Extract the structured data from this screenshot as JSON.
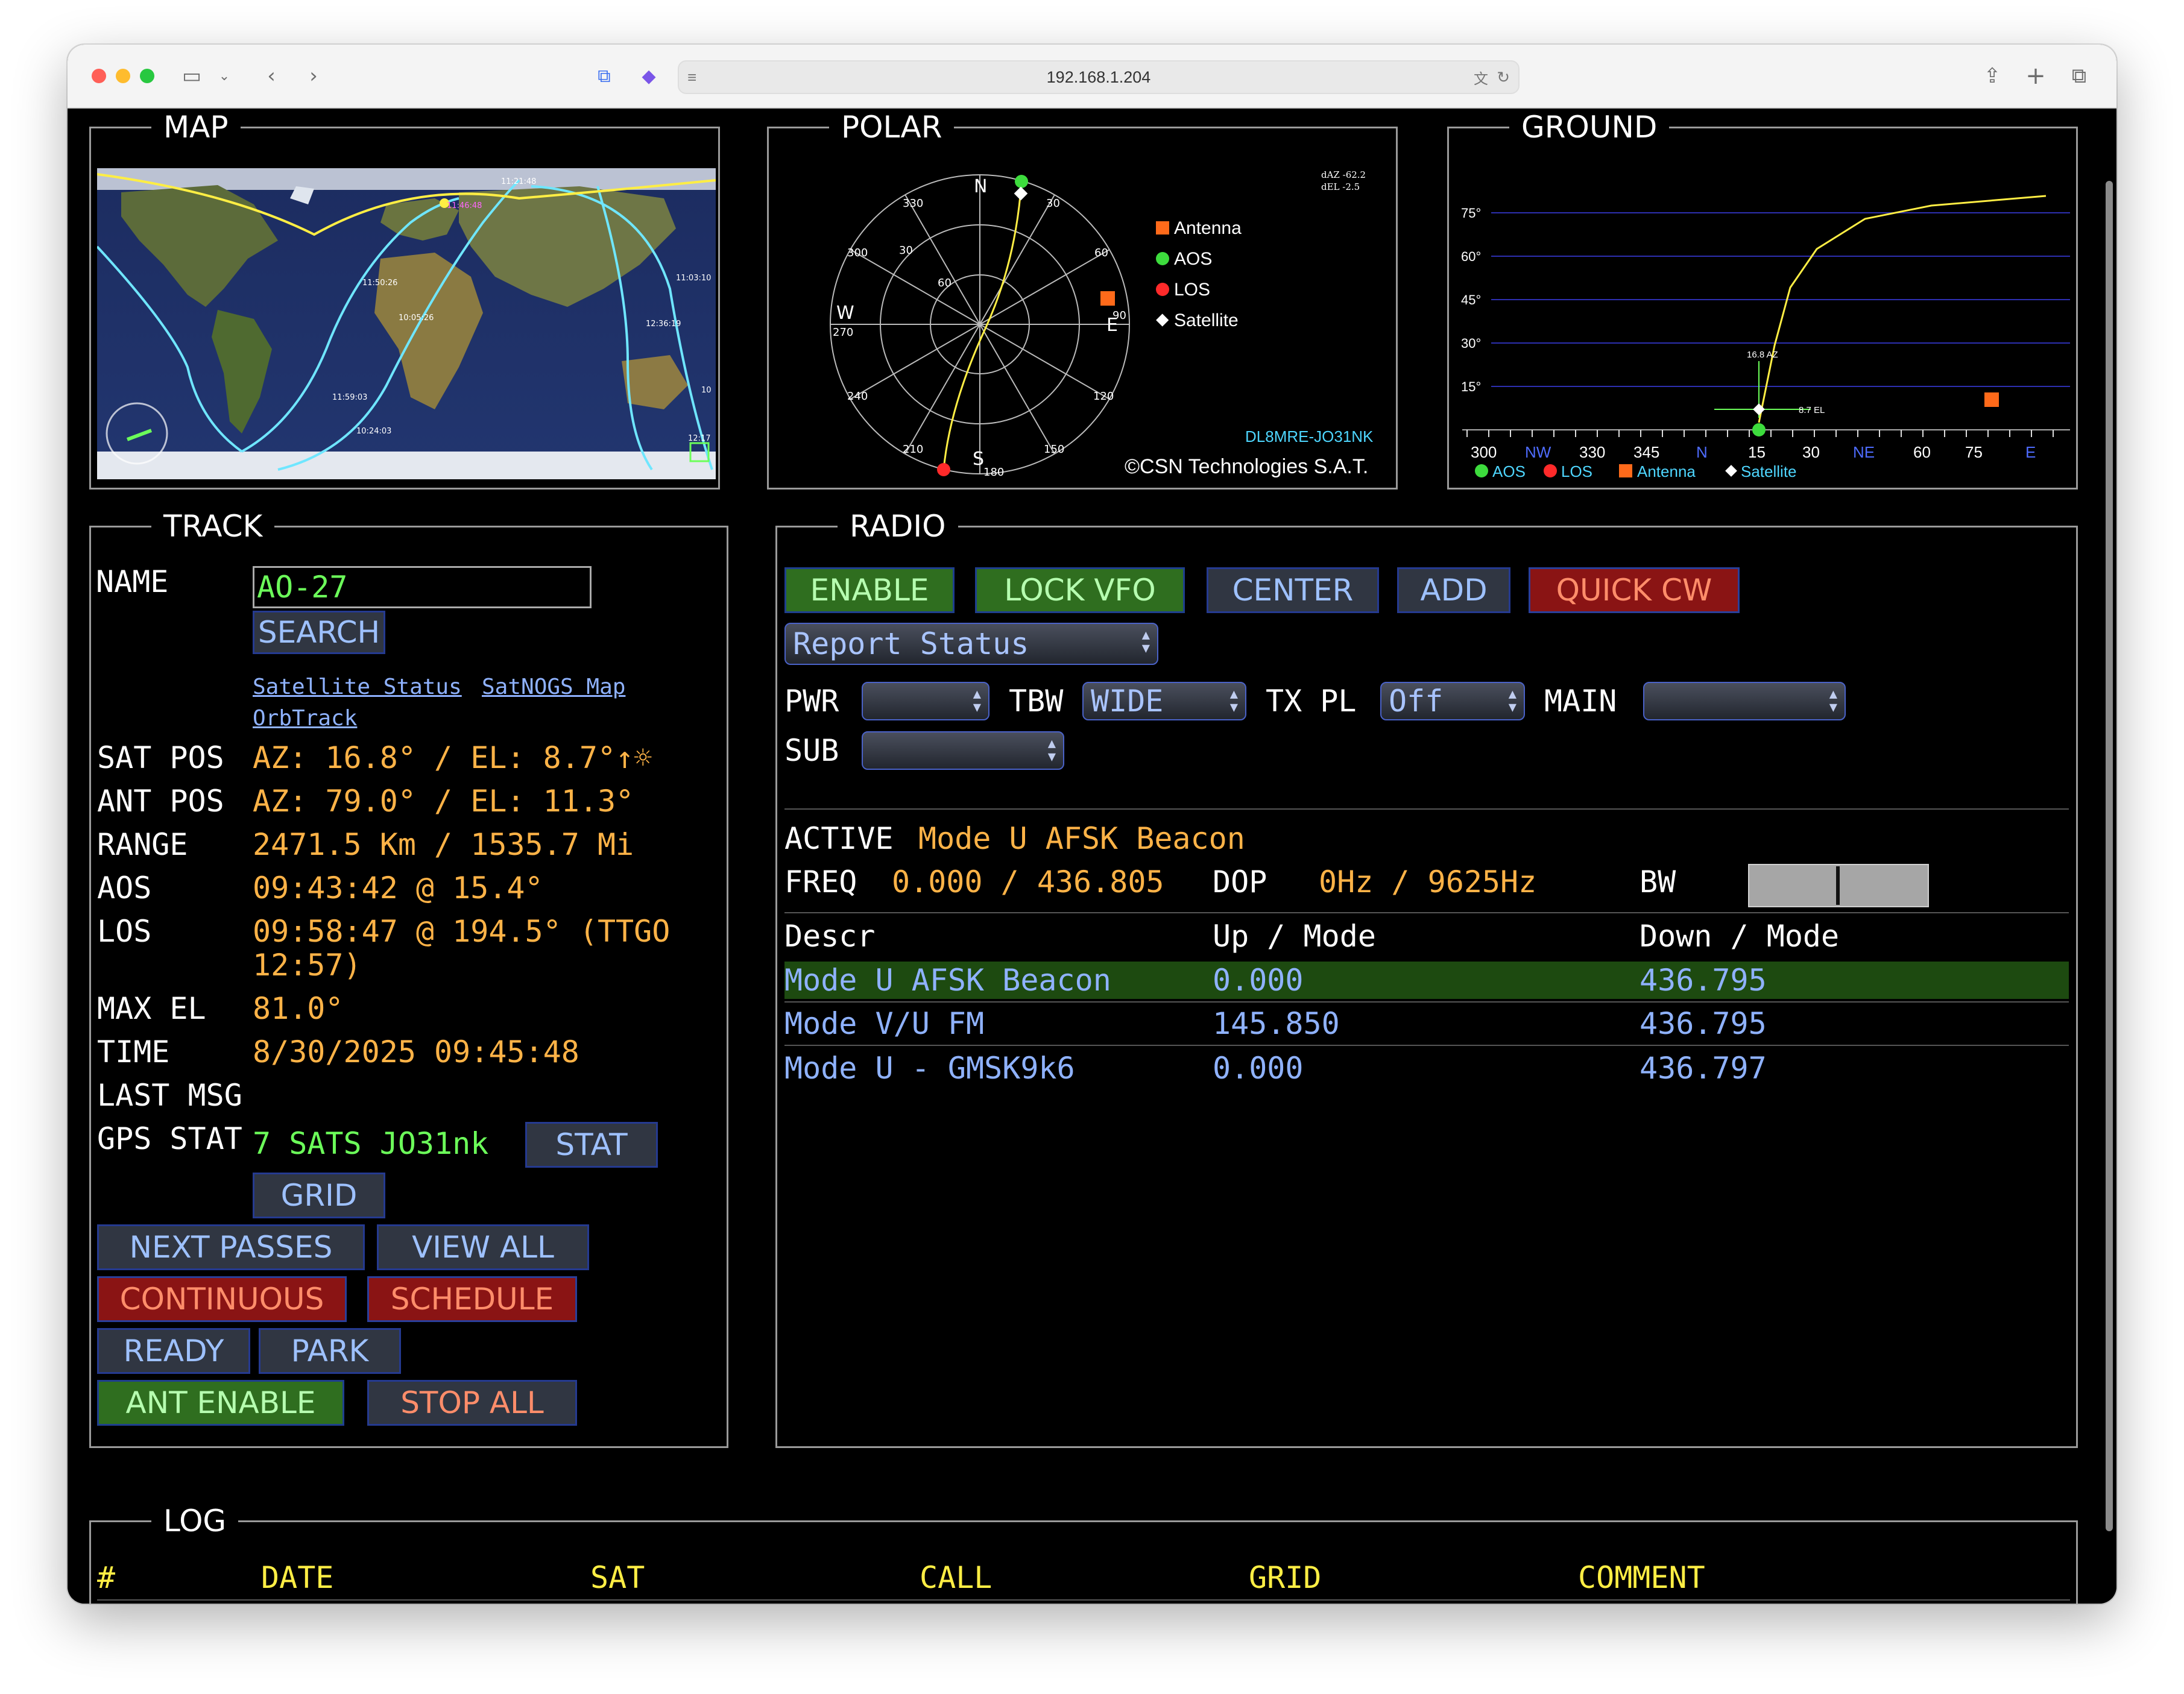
{
  "browser": {
    "url": "192.168.1.204"
  },
  "map": {
    "title": "MAP",
    "times": [
      "11:21:48",
      "11:46:48",
      "11:50:26",
      "11:03:10",
      "10:05:26",
      "12:36:19",
      "11:59:03",
      "10",
      "10:24:03",
      "12:17"
    ]
  },
  "polar": {
    "title": "POLAR",
    "daz": "dAZ -62.2",
    "del": "dEL -2.5",
    "legend": [
      "Antenna",
      "AOS",
      "LOS",
      "Satellite"
    ],
    "directions": [
      "N",
      "E",
      "S",
      "W"
    ],
    "degrees": [
      "330",
      "30",
      "300",
      "60",
      "270",
      "90",
      "240",
      "120",
      "210",
      "150",
      "180"
    ],
    "rings": [
      "30",
      "60"
    ],
    "callsign": "DL8MRE-JO31NK",
    "copyright": "©CSN Technologies S.A.T.",
    "colors": {
      "antenna": "#ff6a1a",
      "aos": "#3ddc3d",
      "los": "#ff2a2a",
      "track": "#ffee44"
    }
  },
  "ground": {
    "title": "GROUND",
    "y_ticks": [
      "75°",
      "60°",
      "45°",
      "30°",
      "15°"
    ],
    "x_ticks": [
      "300",
      "NW",
      "330",
      "345",
      "N",
      "15",
      "30",
      "NE",
      "60",
      "75",
      "E"
    ],
    "az_label": "16.8 AZ",
    "el_label": "8.7 EL",
    "legend": [
      "AOS",
      "LOS",
      "Antenna",
      "Satellite"
    ]
  },
  "track": {
    "title": "TRACK",
    "name_label": "NAME",
    "name_value": "AO-27",
    "search": "SEARCH",
    "links": [
      "Satellite Status",
      "SatNOGS Map",
      "OrbTrack"
    ],
    "rows": [
      {
        "label": "SAT POS",
        "value": "AZ: 16.8° / EL: 8.7°↑☼"
      },
      {
        "label": "ANT POS",
        "value": "AZ: 79.0° / EL: 11.3°"
      },
      {
        "label": "RANGE",
        "value": "2471.5 Km / 1535.7 Mi"
      },
      {
        "label": "AOS",
        "value": "09:43:42 @ 15.4°"
      },
      {
        "label": "LOS",
        "value": "09:58:47 @ 194.5° (TTGO"
      },
      {
        "label": "",
        "value": "12:57)"
      },
      {
        "label": "MAX EL",
        "value": "81.0°"
      },
      {
        "label": "TIME",
        "value": "8/30/2025 09:45:48"
      },
      {
        "label": "LAST MSG",
        "value": ""
      }
    ],
    "gps_label": "GPS STAT",
    "gps_value": "7 SATS JO31nk",
    "stat": "STAT",
    "grid": "GRID",
    "next_passes": "NEXT PASSES",
    "view_all": "VIEW ALL",
    "continuous": "CONTINUOUS",
    "schedule": "SCHEDULE",
    "ready": "READY",
    "park": "PARK",
    "ant_enable": "ANT ENABLE",
    "stop_all": "STOP ALL"
  },
  "radio": {
    "title": "RADIO",
    "enable": "ENABLE",
    "lock_vfo": "LOCK VFO",
    "center": "CENTER",
    "add": "ADD",
    "quick_cw": "QUICK CW",
    "report_status": "Report Status",
    "pwr_label": "PWR",
    "pwr_value": "",
    "tbw_label": "TBW",
    "tbw_value": "WIDE",
    "txpl_label": "TX PL",
    "txpl_value": "Off",
    "main_label": "MAIN",
    "main_value": "",
    "sub_label": "SUB",
    "sub_value": "",
    "active_label": "ACTIVE",
    "active_value": "Mode U AFSK Beacon",
    "freq_label": "FREQ",
    "freq_value": "0.000 / 436.805",
    "dop_label": "DOP",
    "dop_value": "0Hz / 9625Hz",
    "bw_label": "BW",
    "table_headers": [
      "Descr",
      "Up / Mode",
      "Down / Mode"
    ],
    "modes": [
      {
        "descr": "Mode U AFSK Beacon",
        "up": "0.000",
        "down": "436.795",
        "selected": true
      },
      {
        "descr": "Mode V/U FM",
        "up": "145.850",
        "down": "436.795",
        "selected": false
      },
      {
        "descr": "Mode U - GMSK9k6",
        "up": "0.000",
        "down": "436.797",
        "selected": false
      }
    ]
  },
  "log": {
    "title": "LOG",
    "headers": [
      "#",
      "DATE",
      "SAT",
      "CALL",
      "GRID",
      "COMMENT"
    ]
  }
}
